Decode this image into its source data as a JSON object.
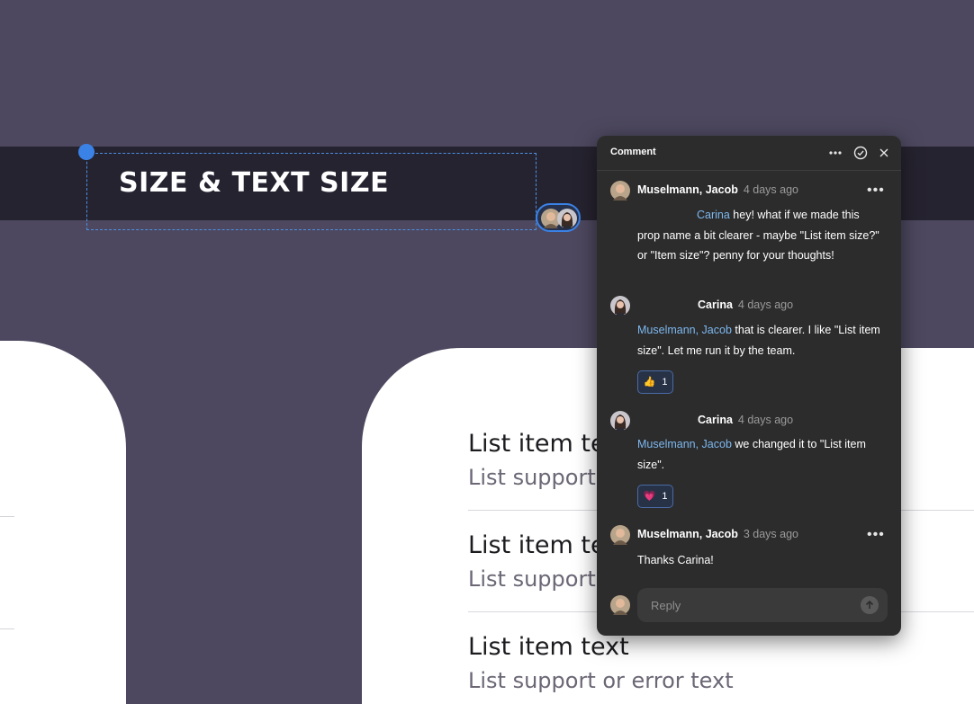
{
  "canvas": {
    "section_title": "SIZE & TEXT SIZE",
    "list_items": [
      {
        "title": "List item text",
        "support": "List support or error text"
      },
      {
        "title": "List item text",
        "support": "List support or error text"
      },
      {
        "title": "List item text",
        "support": "List support or error text"
      }
    ]
  },
  "comment_panel": {
    "title": "Comment",
    "header_icons": [
      "more-options-icon",
      "resolve-check-icon",
      "close-icon"
    ],
    "messages": [
      {
        "author": "Muselmann, Jacob",
        "time": "4 days ago",
        "mention": "Carina",
        "text": " hey! what if we made this prop name a bit clearer - maybe \"List item size?\" or \"Item size\"? penny for your thoughts!"
      },
      {
        "author": "Carina",
        "time": "4 days ago",
        "mention": "Muselmann, Jacob",
        "text": " that is clearer. I like \"List item size\". Let me run it by the team.",
        "reaction": {
          "emoji": "👍",
          "count": "1"
        }
      },
      {
        "author": "Carina",
        "time": "4 days ago",
        "mention": "Muselmann, Jacob",
        "text": " we changed it to \"List item size\".",
        "reaction": {
          "emoji": "💗",
          "count": "1"
        }
      },
      {
        "author": "Muselmann, Jacob",
        "time": "3 days ago",
        "text": "Thanks Carina!"
      }
    ],
    "reply": {
      "placeholder": "Reply"
    }
  },
  "colors": {
    "canvas_bg": "#4d485f",
    "band": "#262330",
    "selection": "#3b82e6",
    "panel_bg": "#2c2c2c",
    "mention": "#7db8ef"
  }
}
